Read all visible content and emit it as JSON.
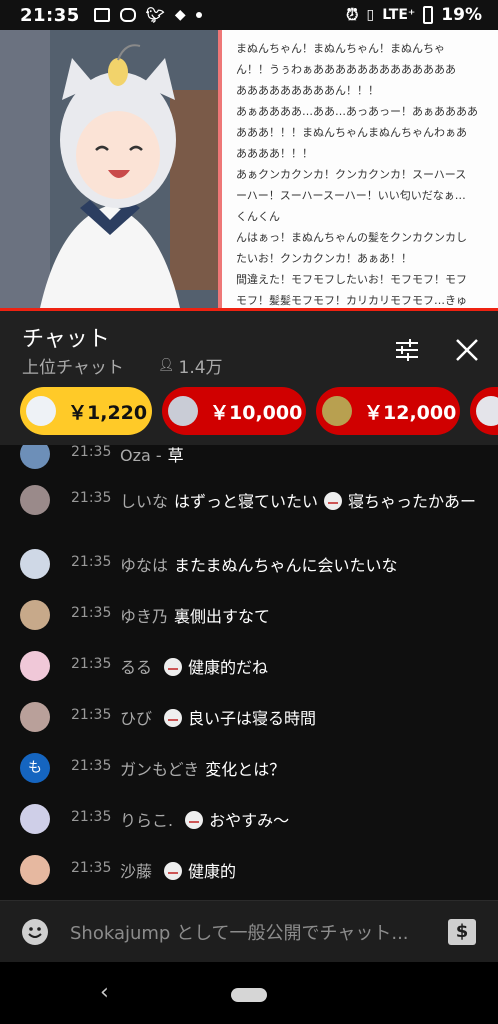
{
  "status_bar": {
    "time": "21:35",
    "network": "LTE⁺",
    "battery": "19%"
  },
  "video": {
    "caption_lines": [
      "まぬんちゃん！まぬんちゃん！まぬんちゃ",
      "ん！！うぅわぁあああああああああああああ",
      "あああああああああん！！！",
      "あぁああああ…ああ…あっあっー！あぁああああ",
      "あああ！！！まぬんちゃんまぬんちゃんわぁあ",
      "ああああ！！！",
      "あぁクンカクンカ！クンカクンカ！スーハース",
      "ーハー！スーハースーハー！いい匂いだなぁ…",
      "くんくん",
      "んはぁっ！まぬんちゃんの髪をクンカクンカし",
      "たいお！クンカクンカ！あぁあ！！",
      "間違えた！モフモフしたいお！モフモフ！モフ",
      "モフ！髪髪モフモフ！カリカリモフモフ…きゅ"
    ]
  },
  "chat_header": {
    "title": "チャット",
    "subtitle": "上位チャット",
    "viewers": "1.4万"
  },
  "superchats": [
    {
      "amount": "￥1,220",
      "color": "#ffca28",
      "text_color": "#111"
    },
    {
      "amount": "￥10,000",
      "color": "#d00000",
      "text_color": "#fff"
    },
    {
      "amount": "￥12,000",
      "color": "#d00000",
      "text_color": "#fff"
    },
    {
      "amount": "",
      "color": "#d00000",
      "text_color": "#fff"
    }
  ],
  "messages": [
    {
      "time": "21:35",
      "author": "Oza -",
      "text": "草",
      "emoji": false,
      "avatar_color": "#6d8fb8"
    },
    {
      "time": "21:35",
      "author": "しいな",
      "text": "はずっと寝ていたい",
      "text2": "寝ちゃったかあー",
      "emoji": true,
      "avatar_color": "#9a8a8a"
    },
    {
      "time": "21:35",
      "author": "ゆなは",
      "text": "またまぬんちゃんに会いたいな",
      "emoji": false,
      "avatar_color": "#cfd8e6"
    },
    {
      "time": "21:35",
      "author": "ゆき乃",
      "text": "裏側出すなて",
      "emoji": false,
      "avatar_color": "#c7a98a"
    },
    {
      "time": "21:35",
      "author": "るる",
      "text": "健康的だね",
      "emoji": true,
      "avatar_color": "#f0c8d8"
    },
    {
      "time": "21:35",
      "author": "ひび",
      "text": "良い子は寝る時間",
      "emoji": true,
      "avatar_color": "#b9a09a"
    },
    {
      "time": "21:35",
      "author": "ガンもどき",
      "text": "変化とは？",
      "emoji": false,
      "avatar_color": "#1565c0",
      "avatar_letter": "も"
    },
    {
      "time": "21:35",
      "author": "りらこ.",
      "text": "おやすみ〜",
      "emoji": true,
      "avatar_color": "#cfcfe8"
    },
    {
      "time": "21:35",
      "author": "沙藤",
      "text": "健康的",
      "emoji": true,
      "avatar_color": "#e6b8a0"
    }
  ],
  "input": {
    "placeholder": "Shokajump として一般公開でチャット..."
  },
  "icons": {
    "emoji_button": "smile-icon",
    "superchat_button": "currency-icon",
    "filter": "sliders-icon",
    "close": "close-icon",
    "back": "back-icon",
    "home": "home-pill-icon"
  }
}
